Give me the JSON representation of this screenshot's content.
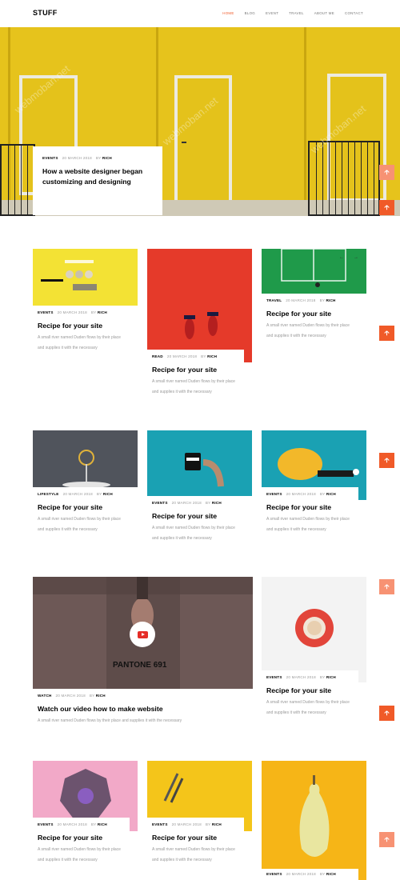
{
  "site": {
    "logo": "STUFF",
    "nav": [
      "HOME",
      "BLOG",
      "EVENT",
      "TRAVEL",
      "ABOUT ME",
      "CONTACT"
    ],
    "active_nav": "HOME",
    "accent_color": "#f05a28"
  },
  "hero": {
    "category": "EVENTS",
    "date": "20 MARCH 2018",
    "by": "BY",
    "author": "RICH",
    "title": "How a website designer began customizing and designing"
  },
  "cards": [
    {
      "category": "EVENTS",
      "date": "20 MARCH 2018",
      "by": "BY",
      "author": "RICH",
      "title": "Recipe for your site",
      "desc": "A small river named Duden flows by their place and supplies it with the necessary"
    },
    {
      "category": "READ",
      "date": "20 MARCH 2018",
      "by": "BY",
      "author": "RICH",
      "title": "Recipe for your site",
      "desc": "A small river named Duden flows by their place and supplies it with the necessary"
    },
    {
      "category": "TRAVEL",
      "date": "20 MARCH 2018",
      "by": "BY",
      "author": "RICH",
      "title": "Recipe for your site",
      "desc": "A small river named Duden flows by their place and supplies it with the necessary"
    },
    {
      "category": "LIFESTYLE",
      "date": "20 MARCH 2018",
      "by": "BY",
      "author": "RICH",
      "title": "Recipe for your site",
      "desc": "A small river named Duden flows by their place and supplies it with the necessary"
    },
    {
      "category": "EVENTS",
      "date": "20 MARCH 2018",
      "by": "BY",
      "author": "RICH",
      "title": "Recipe for your site",
      "desc": "A small river named Duden flows by their place and supplies it with the necessary"
    },
    {
      "category": "EVENTS",
      "date": "20 MARCH 2018",
      "by": "BY",
      "author": "RICH",
      "title": "Recipe for your site",
      "desc": "A small river named Duden flows by their place and supplies it with the necessary"
    },
    {
      "category": "WATCH",
      "date": "20 MARCH 2018",
      "by": "BY",
      "author": "RICH",
      "title": "Watch our video how to make website",
      "desc": "A small river named Duden flows by their place and supplies it with the necessary",
      "image_text": "PANTONE 691"
    },
    {
      "category": "EVENTS",
      "date": "20 MARCH 2018",
      "by": "BY",
      "author": "RICH",
      "title": "Recipe for your site",
      "desc": "A small river named Duden flows by their place and supplies it with the necessary"
    },
    {
      "category": "EVENTS",
      "date": "20 MARCH 2018",
      "by": "BY",
      "author": "RICH",
      "title": "Recipe for your site",
      "desc": "A small river named Duden flows by their place and supplies it with the necessary"
    },
    {
      "category": "EVENTS",
      "date": "20 MARCH 2018",
      "by": "BY",
      "author": "RICH",
      "title": "Recipe for your site",
      "desc": "A small river named Duden flows by their place and supplies it with the necessary"
    },
    {
      "category": "EVENTS",
      "date": "20 MARCH 2018",
      "by": "BY",
      "author": "RICH"
    }
  ],
  "watermark": "webmoban.net",
  "icons": {
    "scroll_top": "arrow-up-icon",
    "slider_prev": "arrow-left-icon",
    "slider_next": "arrow-right-icon",
    "video": "youtube-play-icon"
  }
}
